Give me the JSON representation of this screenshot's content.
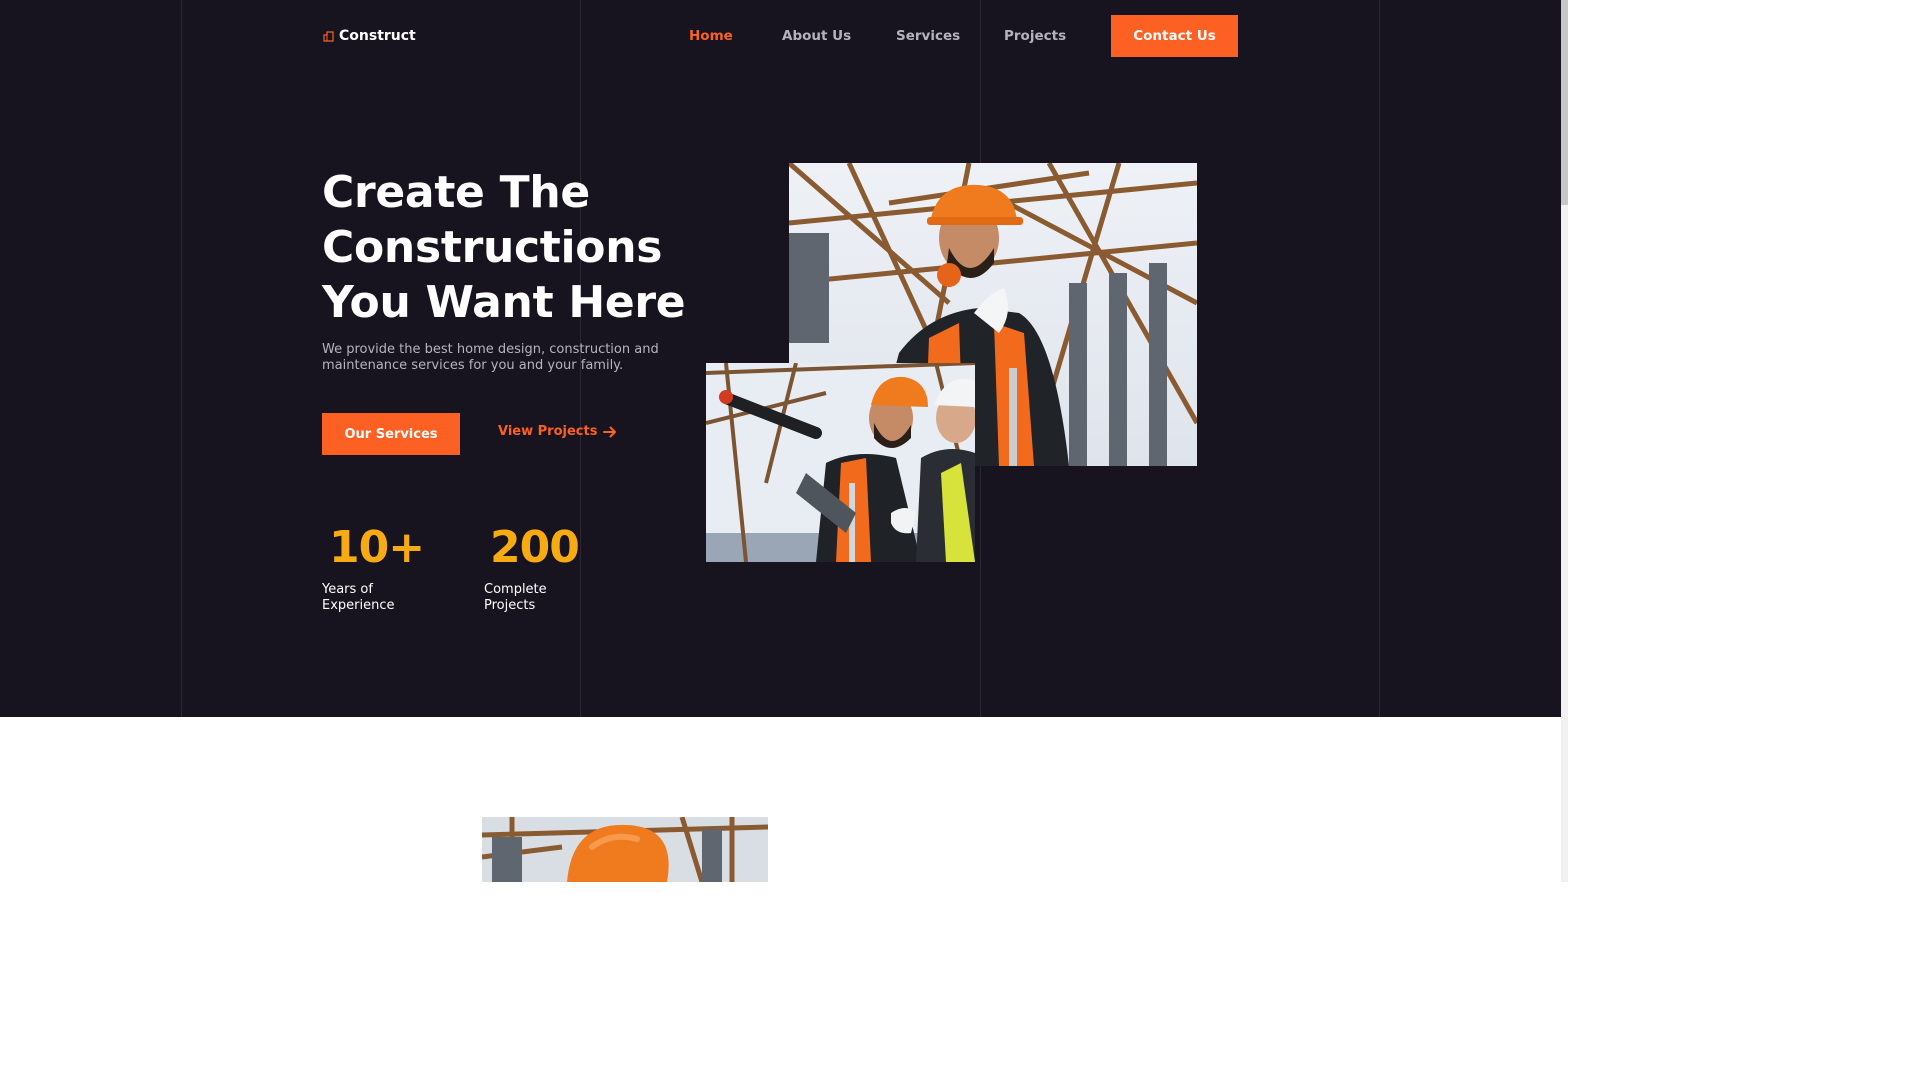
{
  "brand": {
    "name": "Construct",
    "accent": "#fc6022",
    "stat_color": "#f7ab12",
    "bg": "#17141f"
  },
  "nav": {
    "home": "Home",
    "about": "About Us",
    "services": "Services",
    "projects": "Projects",
    "contact": "Contact Us",
    "active": "Home"
  },
  "hero": {
    "headline_1": "Create The",
    "headline_2": "Constructions",
    "headline_3": "You Want Here",
    "subtext": "We provide the best home design, construction and maintenance services for you and your family.",
    "primary_button": "Our Services",
    "secondary_link": "View Projects",
    "stats": [
      {
        "value": "10+",
        "label_1": "Years of",
        "label_2": "Experience"
      },
      {
        "value": "200",
        "label_1": "Complete",
        "label_2": "Projects"
      }
    ]
  },
  "icons": {
    "logo": "building-icon",
    "link_arrow": "arrow-right-icon"
  }
}
